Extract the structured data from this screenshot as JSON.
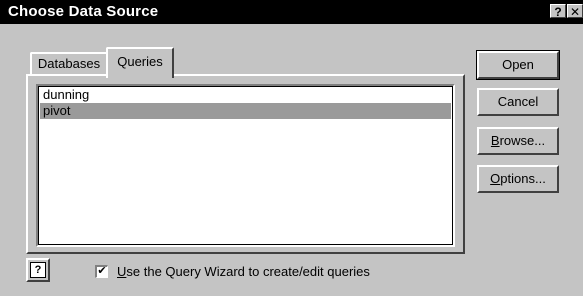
{
  "window": {
    "title": "Choose Data Source",
    "help_glyph": "?",
    "close_glyph": "✕"
  },
  "tabs": [
    {
      "label": "Databases",
      "active": false
    },
    {
      "label": "Queries",
      "active": true
    }
  ],
  "list": {
    "items": [
      {
        "label": "dunning",
        "selected": false
      },
      {
        "label": "pivot",
        "selected": true
      }
    ]
  },
  "buttons": {
    "open": {
      "pre": "",
      "key": "",
      "post": "Open"
    },
    "cancel": {
      "pre": "",
      "key": "",
      "post": "Cancel"
    },
    "browse": {
      "pre": "",
      "key": "B",
      "post": "rowse..."
    },
    "options": {
      "pre": "",
      "key": "O",
      "post": "ptions..."
    }
  },
  "help_button": {
    "glyph": "?"
  },
  "wizard_option": {
    "checked": true,
    "check_glyph": "✔",
    "key": "U",
    "label_rest": "se the Query Wizard to create/edit queries"
  }
}
